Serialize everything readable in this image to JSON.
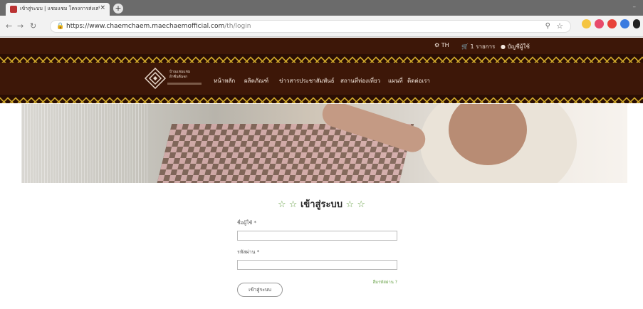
{
  "browser": {
    "tab_title": "เข้าสู่ระบบ | แชมแชม โครงการส่งเสริม...",
    "tab_close": "×",
    "new_tab": "+",
    "url_host": "https://www.chaemchaem.maechaemofficial.com",
    "url_path": "/th/login"
  },
  "site": {
    "language": "TH",
    "cart": "1 รายการ",
    "account": "บัญชีผู้ใช้",
    "logo_text": "บ้านแชมแชม",
    "logo_subtext": "ผ้าซิ่นตีนจก"
  },
  "menu": {
    "items": [
      "หน้าหลัก",
      "ผลิตภัณฑ์",
      "ข่าวสารประชาสัมพันธ์",
      "สถานที่ท่องเที่ยว",
      "แผนที่",
      "ติดต่อเรา"
    ]
  },
  "login": {
    "stars_left": "☆ ☆",
    "title": "เข้าสู่ระบบ",
    "stars_right": "☆ ☆",
    "username_label": "ชื่อผู้ใช้ *",
    "username_value": "",
    "password_label": "รหัสผ่าน *",
    "password_value": "",
    "forgot_label": "ลืมรหัสผ่าน ?",
    "submit_label": "เข้าสู่ระบบ"
  },
  "colors": {
    "header_brown": "#3d1708",
    "pattern_gold": "#c9a229",
    "accent_green": "#6aa34a"
  },
  "icons": [
    "globe-icon",
    "cart-icon",
    "user-icon",
    "lock-icon",
    "star-icon",
    "zoom-icon"
  ]
}
